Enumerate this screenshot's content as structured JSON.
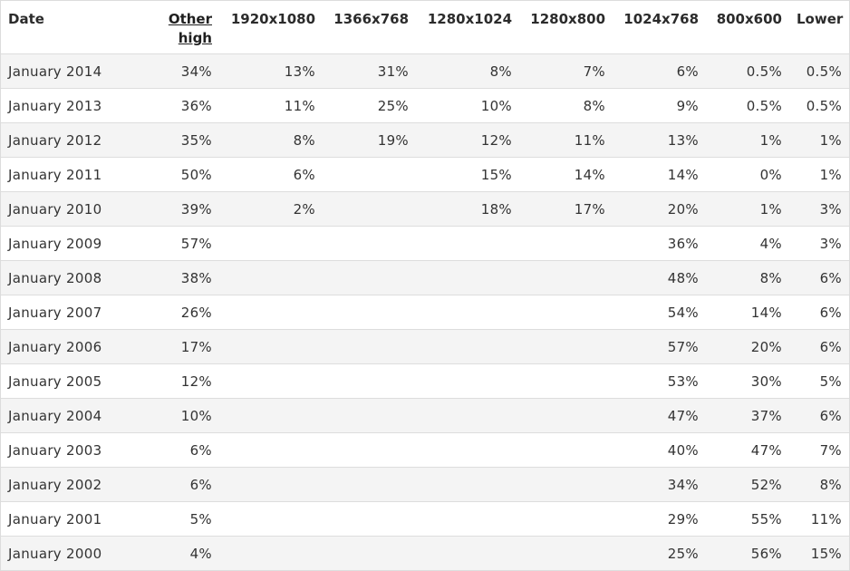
{
  "table": {
    "headers": [
      {
        "label": "Date",
        "link": false
      },
      {
        "label": "Other high",
        "link": true
      },
      {
        "label": "1920x1080",
        "link": false
      },
      {
        "label": "1366x768",
        "link": false
      },
      {
        "label": "1280x1024",
        "link": false
      },
      {
        "label": "1280x800",
        "link": false
      },
      {
        "label": "1024x768",
        "link": false
      },
      {
        "label": "800x600",
        "link": false
      },
      {
        "label": "Lower",
        "link": false
      }
    ],
    "rows": [
      [
        "January 2014",
        "34%",
        "13%",
        "31%",
        "8%",
        "7%",
        "6%",
        "0.5%",
        "0.5%"
      ],
      [
        "January 2013",
        "36%",
        "11%",
        "25%",
        "10%",
        "8%",
        "9%",
        "0.5%",
        "0.5%"
      ],
      [
        "January 2012",
        "35%",
        "8%",
        "19%",
        "12%",
        "11%",
        "13%",
        "1%",
        "1%"
      ],
      [
        "January 2011",
        "50%",
        "6%",
        "",
        "15%",
        "14%",
        "14%",
        "0%",
        "1%"
      ],
      [
        "January 2010",
        "39%",
        "2%",
        "",
        "18%",
        "17%",
        "20%",
        "1%",
        "3%"
      ],
      [
        "January 2009",
        "57%",
        "",
        "",
        "",
        "",
        "36%",
        "4%",
        "3%"
      ],
      [
        "January 2008",
        "38%",
        "",
        "",
        "",
        "",
        "48%",
        "8%",
        "6%"
      ],
      [
        "January 2007",
        "26%",
        "",
        "",
        "",
        "",
        "54%",
        "14%",
        "6%"
      ],
      [
        "January 2006",
        "17%",
        "",
        "",
        "",
        "",
        "57%",
        "20%",
        "6%"
      ],
      [
        "January 2005",
        "12%",
        "",
        "",
        "",
        "",
        "53%",
        "30%",
        "5%"
      ],
      [
        "January 2004",
        "10%",
        "",
        "",
        "",
        "",
        "47%",
        "37%",
        "6%"
      ],
      [
        "January 2003",
        "6%",
        "",
        "",
        "",
        "",
        "40%",
        "47%",
        "7%"
      ],
      [
        "January 2002",
        "6%",
        "",
        "",
        "",
        "",
        "34%",
        "52%",
        "8%"
      ],
      [
        "January 2001",
        "5%",
        "",
        "",
        "",
        "",
        "29%",
        "55%",
        "11%"
      ],
      [
        "January 2000",
        "4%",
        "",
        "",
        "",
        "",
        "25%",
        "56%",
        "15%"
      ]
    ]
  },
  "colors": {
    "text": "#333333",
    "row_alt_bg": "#f4f4f4",
    "row_bg": "#ffffff",
    "border": "#dddddd"
  }
}
